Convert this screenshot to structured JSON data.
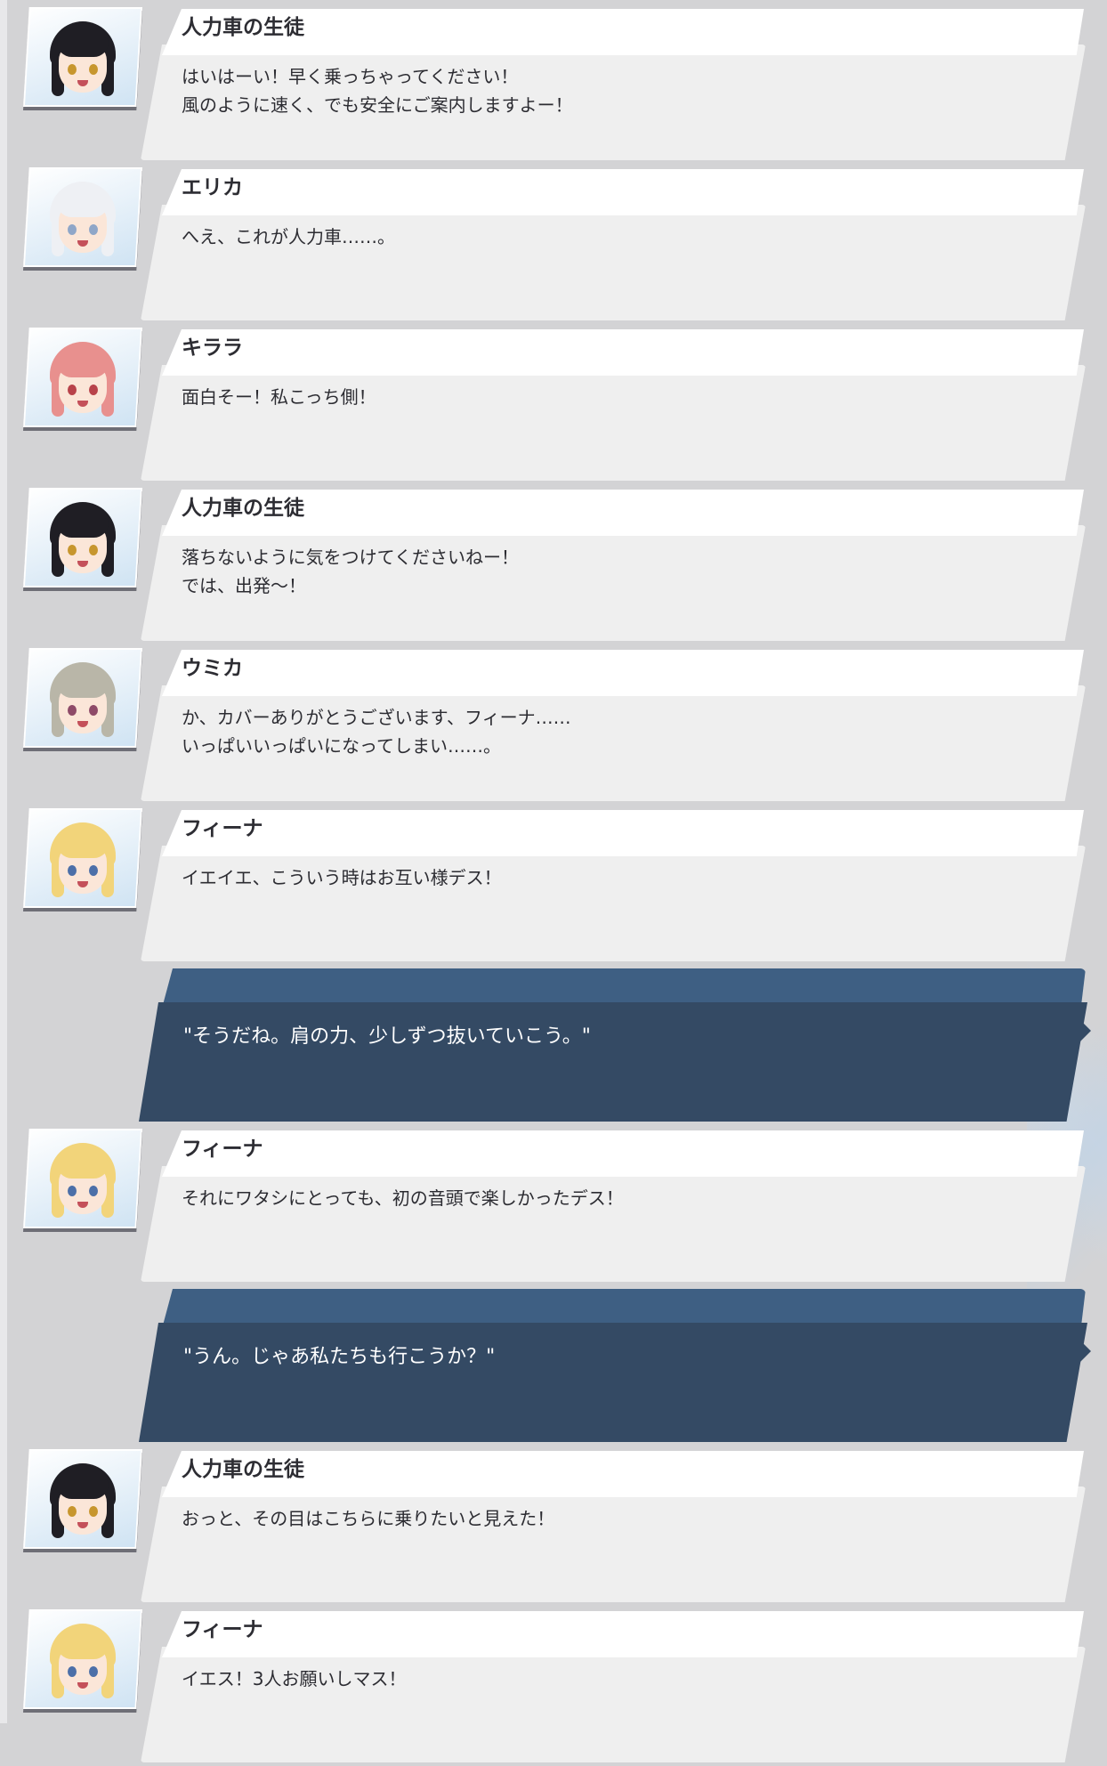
{
  "entries": [
    {
      "type": "npc",
      "speaker": "人力車の生徒",
      "avatar": "rickshaw-student",
      "lines": [
        "はいはーい！早く乗っちゃってください！",
        "風のように速く、でも安全にご案内しますよー！"
      ]
    },
    {
      "type": "npc",
      "speaker": "エリカ",
      "avatar": "erika",
      "lines": [
        "へえ、これが人力車……。"
      ]
    },
    {
      "type": "npc",
      "speaker": "キララ",
      "avatar": "kirara",
      "lines": [
        "面白そー！私こっち側！"
      ]
    },
    {
      "type": "npc",
      "speaker": "人力車の生徒",
      "avatar": "rickshaw-student",
      "lines": [
        "落ちないように気をつけてくださいねー！",
        "では、出発〜！"
      ]
    },
    {
      "type": "npc",
      "speaker": "ウミカ",
      "avatar": "umika",
      "lines": [
        "か、カバーありがとうございます、フィーナ……",
        "いっぱいいっぱいになってしまい……。"
      ]
    },
    {
      "type": "npc",
      "speaker": "フィーナ",
      "avatar": "fiina",
      "lines": [
        "イエイエ、こういう時はお互い様デス！"
      ]
    },
    {
      "type": "player",
      "lines": [
        "\"そうだね。肩の力、少しずつ抜いていこう。\""
      ]
    },
    {
      "type": "npc",
      "speaker": "フィーナ",
      "avatar": "fiina",
      "lines": [
        "それにワタシにとっても、初の音頭で楽しかったデス！"
      ]
    },
    {
      "type": "player",
      "lines": [
        "\"うん。じゃあ私たちも行こうか？\""
      ]
    },
    {
      "type": "npc",
      "speaker": "人力車の生徒",
      "avatar": "rickshaw-student",
      "lines": [
        "おっと、その目はこちらに乗りたいと見えた！"
      ]
    },
    {
      "type": "npc",
      "speaker": "フィーナ",
      "avatar": "fiina",
      "lines": [
        "イエス！3人お願いしマス！"
      ]
    }
  ],
  "avatars": {
    "rickshaw-student": {
      "hair": "#1f1e24",
      "eyes": "#c7962e",
      "accent": "#ffffff"
    },
    "erika": {
      "hair": "#eef0f4",
      "eyes": "#8fa6c8",
      "accent": "#2a2a30"
    },
    "kirara": {
      "hair": "#e8908e",
      "eyes": "#b8424a",
      "accent": "#f6c2c0"
    },
    "umika": {
      "hair": "#b9b6a8",
      "eyes": "#8e4a68",
      "accent": "#3a3a44"
    },
    "fiina": {
      "hair": "#f2d47a",
      "eyes": "#4c6fa8",
      "accent": "#2b2e3a"
    }
  },
  "colors": {
    "background": "#d3d3d5",
    "bubble": "#efefef",
    "name_tab": "#ffffff",
    "player_bubble": "#344a64",
    "player_tab": "#3e5f83"
  }
}
